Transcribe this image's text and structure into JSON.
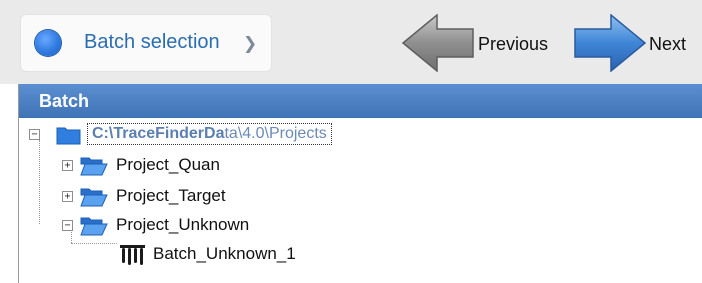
{
  "workflow": {
    "step_label": "Batch selection",
    "step_chevron": "❯",
    "previous_label": "Previous",
    "next_label": "Next"
  },
  "panel": {
    "title": "Batch"
  },
  "tree": {
    "root": {
      "label_bold": "C:\\TraceFinderDa",
      "label_rest": "ta\\4.0\\Projects",
      "expander": "−"
    },
    "projects": [
      {
        "label": "Project_Quan",
        "expander": "+"
      },
      {
        "label": "Project_Target",
        "expander": "+"
      },
      {
        "label": "Project_Unknown",
        "expander": "−"
      }
    ],
    "batch": {
      "label": "Batch_Unknown_1"
    }
  },
  "colors": {
    "header_blue": "#4a7fc1",
    "arrow_blue": "#3f85d6",
    "arrow_gray": "#8f8f8f",
    "root_text": "#6a8ab8"
  }
}
